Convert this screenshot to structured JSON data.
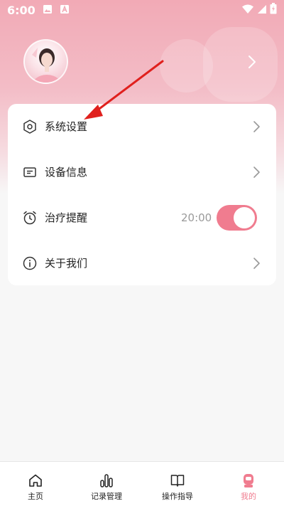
{
  "status_bar": {
    "time": "6:00"
  },
  "colors": {
    "accent": "#f07c8f",
    "header_top": "#f2aab6",
    "annotation_arrow": "#e0201d"
  },
  "settings": {
    "items": [
      {
        "label": "系统设置",
        "icon": "hexagon-settings-icon",
        "control": "chevron"
      },
      {
        "label": "设备信息",
        "icon": "device-info-icon",
        "control": "chevron"
      },
      {
        "label": "治疗提醒",
        "icon": "alarm-clock-icon",
        "control": "toggle",
        "time": "20:00",
        "enabled": true
      },
      {
        "label": "关于我们",
        "icon": "info-circle-icon",
        "control": "chevron"
      }
    ]
  },
  "tabbar": {
    "tabs": [
      {
        "label": "主页",
        "icon": "home-icon",
        "active": false
      },
      {
        "label": "记录管理",
        "icon": "bar-chart-icon",
        "active": false
      },
      {
        "label": "操作指导",
        "icon": "book-icon",
        "active": false
      },
      {
        "label": "我的",
        "icon": "profile-icon",
        "active": true
      }
    ]
  }
}
